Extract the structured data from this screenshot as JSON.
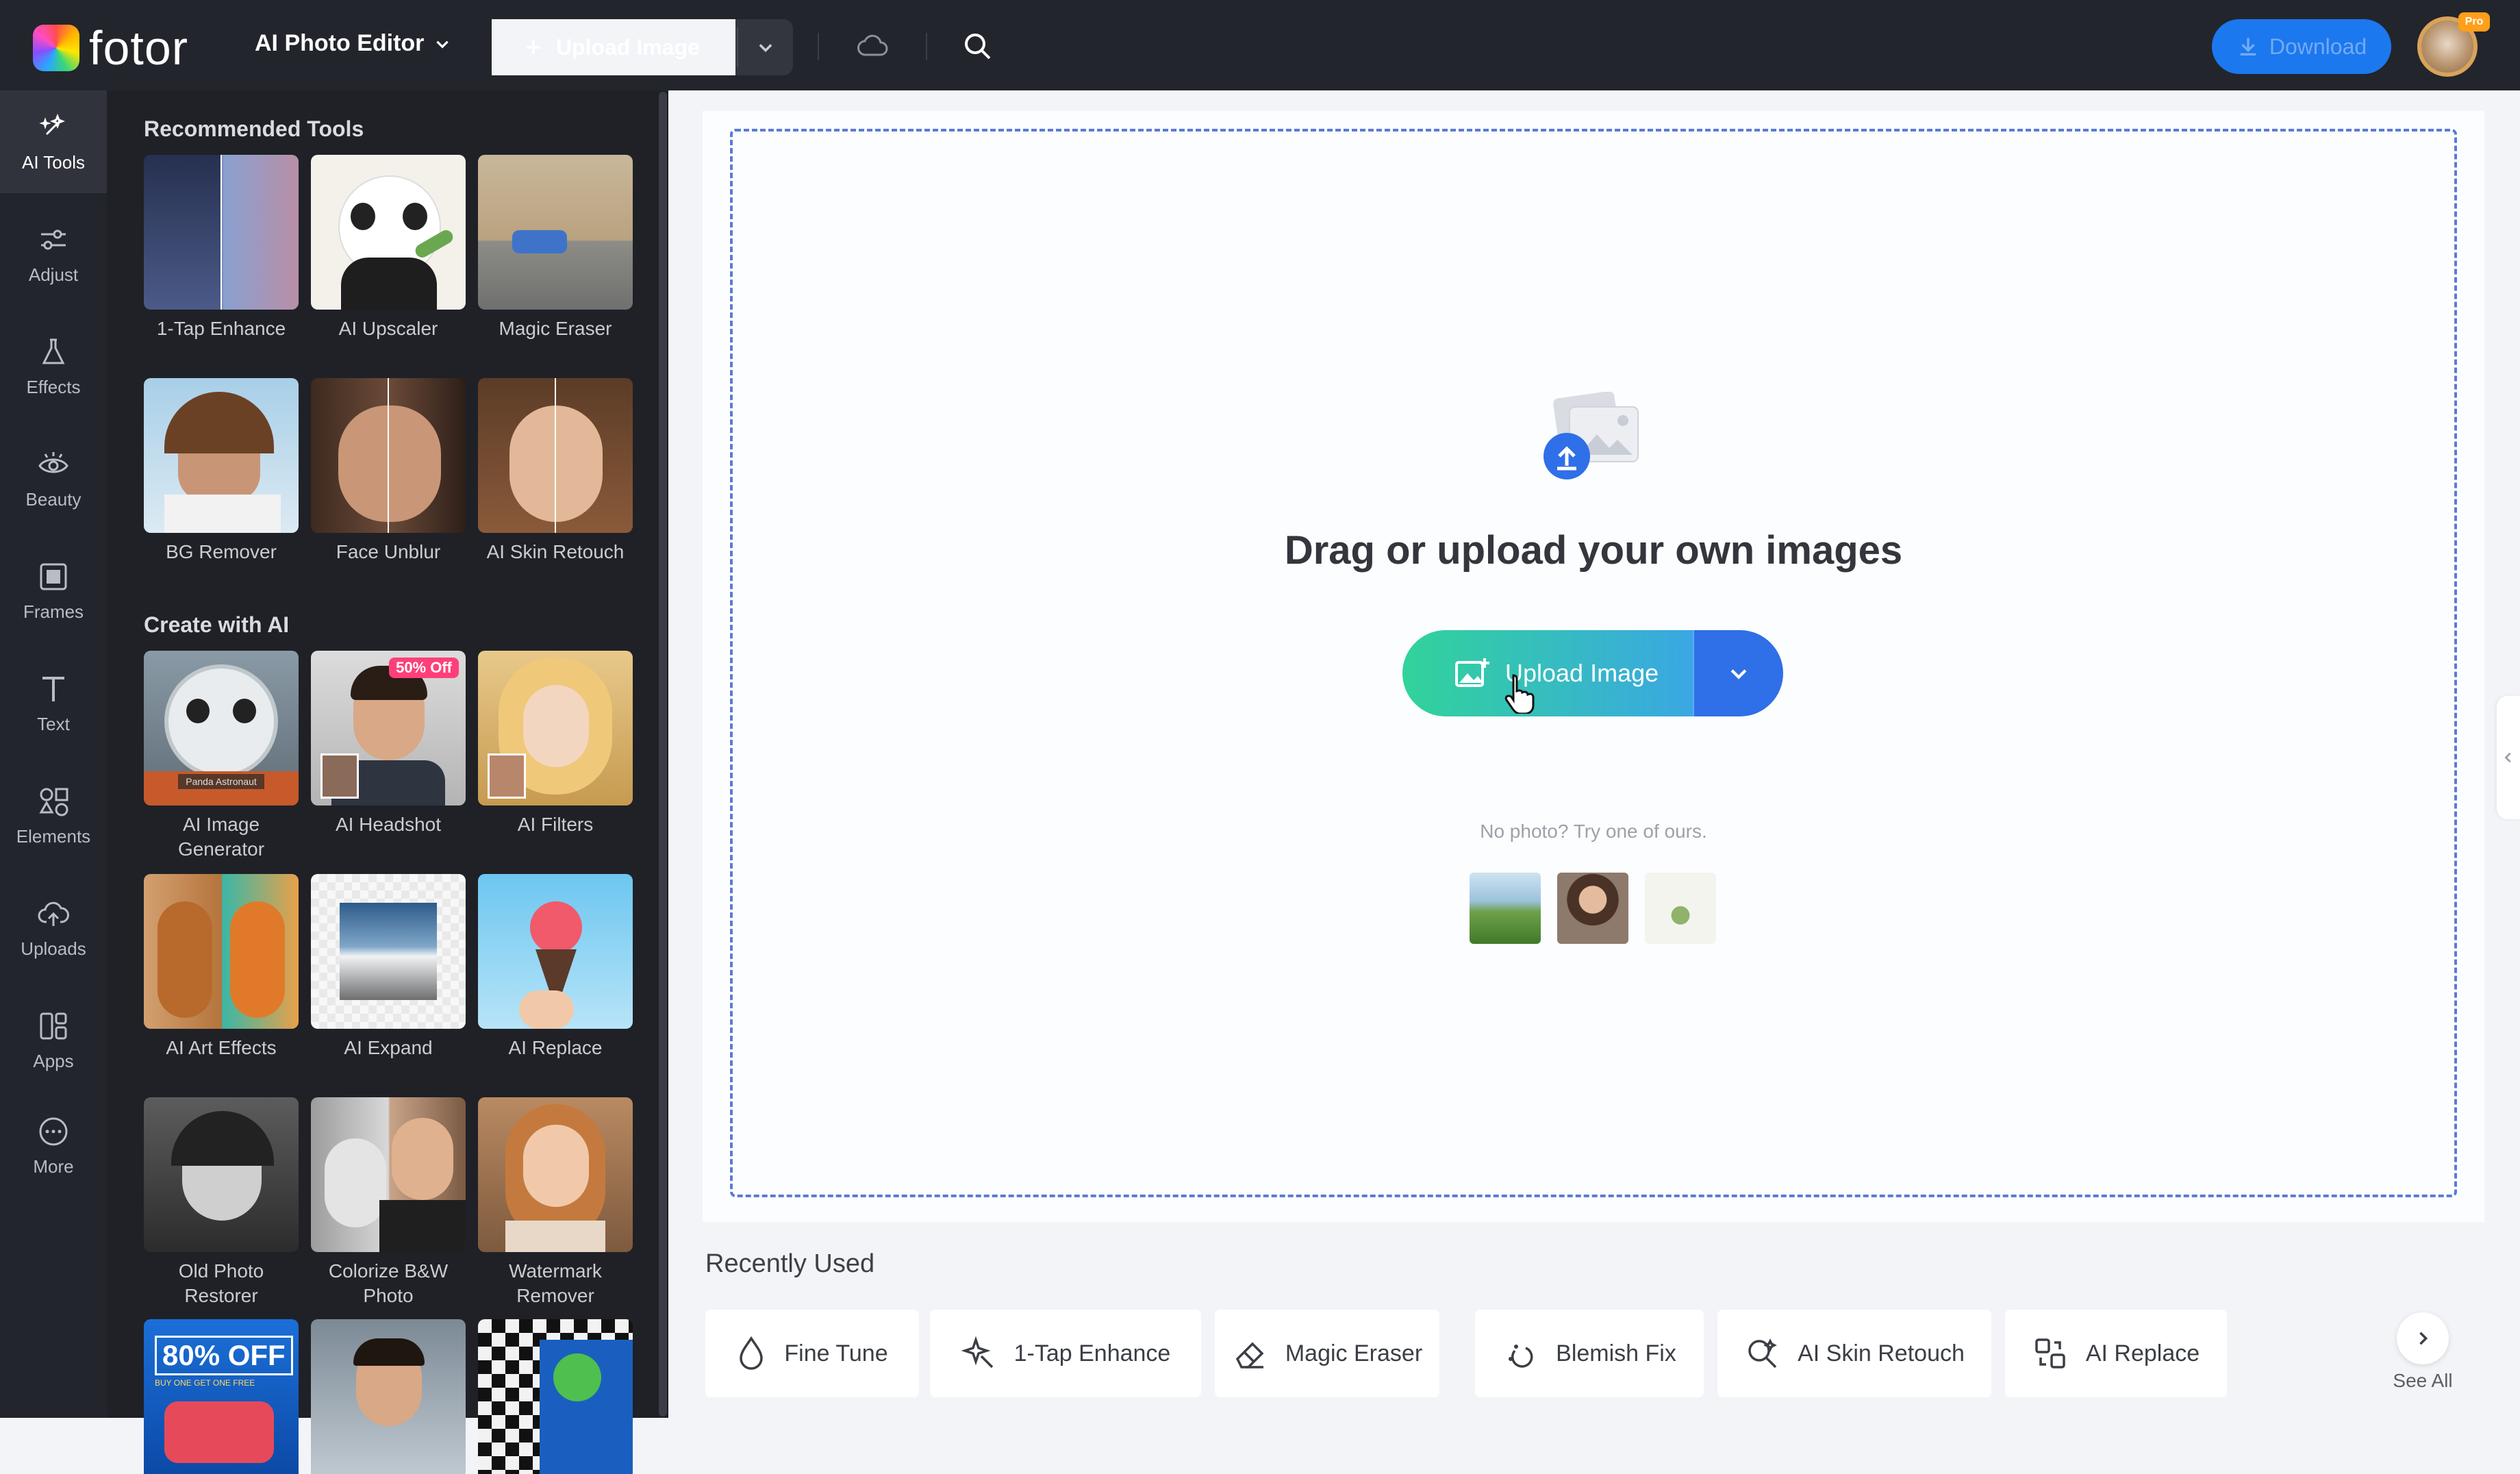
{
  "app": {
    "name": "fotor",
    "mode_selector": "AI Photo Editor",
    "pro_badge": "Pro"
  },
  "topbar": {
    "upload_label": "Upload Image",
    "download_label": "Download"
  },
  "rail": [
    {
      "label": "AI Tools",
      "icon": "ai-tools-icon",
      "active": true
    },
    {
      "label": "Adjust",
      "icon": "sliders-icon"
    },
    {
      "label": "Effects",
      "icon": "flask-icon"
    },
    {
      "label": "Beauty",
      "icon": "eye-icon"
    },
    {
      "label": "Frames",
      "icon": "frame-icon"
    },
    {
      "label": "Text",
      "icon": "text-icon"
    },
    {
      "label": "Elements",
      "icon": "shapes-icon"
    },
    {
      "label": "Uploads",
      "icon": "cloud-upload-icon"
    },
    {
      "label": "Apps",
      "icon": "apps-icon"
    },
    {
      "label": "More",
      "icon": "more-icon"
    }
  ],
  "panel": {
    "recommended_title": "Recommended Tools",
    "recommended": [
      "1-Tap Enhance",
      "AI Upscaler",
      "Magic Eraser",
      "BG Remover",
      "Face Unblur",
      "AI Skin Retouch"
    ],
    "create_title": "Create with AI",
    "create": [
      "AI Image Generator",
      "AI Headshot",
      "AI Filters",
      "AI Art Effects",
      "AI Expand",
      "AI Replace",
      "Old Photo Restorer",
      "Colorize B&W Photo",
      "Watermark Remover"
    ],
    "headshot_badge": "50% Off",
    "promo_text": "80% OFF",
    "promo_sub": "BUY ONE GET ONE FREE",
    "generator_caption": "Panda Astronaut"
  },
  "canvas": {
    "drag_text": "Drag or upload your own images",
    "upload_button": "Upload Image",
    "no_photo_text": "No photo? Try one of ours."
  },
  "recently_used": {
    "title": "Recently Used",
    "items": [
      {
        "label": "Fine Tune",
        "icon": "drop-icon"
      },
      {
        "label": "1-Tap Enhance",
        "icon": "sparkle-enhance-icon"
      },
      {
        "label": "Magic Eraser",
        "icon": "eraser-icon"
      },
      {
        "label": "Blemish Fix",
        "icon": "blemish-icon"
      },
      {
        "label": "AI Skin Retouch",
        "icon": "skin-retouch-icon"
      },
      {
        "label": "AI Replace",
        "icon": "replace-icon"
      }
    ],
    "see_all": "See All"
  },
  "colors": {
    "accent": "#1b78ee",
    "dark_bg": "#23252c",
    "panel_bg": "#1f2127",
    "dashed": "#5a7bd8"
  }
}
